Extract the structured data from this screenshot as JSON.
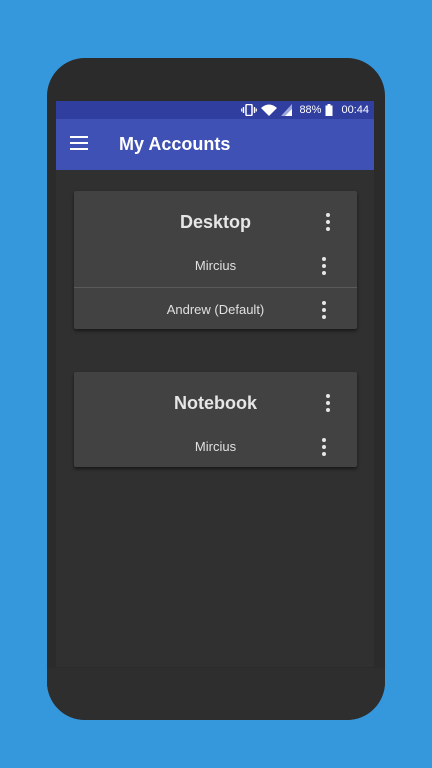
{
  "status": {
    "battery_percent": "88%",
    "time": "00:44"
  },
  "appbar": {
    "title": "My Accounts"
  },
  "groups": [
    {
      "name": "Desktop",
      "accounts": [
        "Mircius",
        "Andrew (Default)"
      ]
    },
    {
      "name": "Notebook",
      "accounts": [
        "Mircius"
      ]
    }
  ],
  "colors": {
    "appbar": "#3f51b5",
    "statusbar": "#303f9f",
    "background": "#303030",
    "card": "#424242"
  }
}
